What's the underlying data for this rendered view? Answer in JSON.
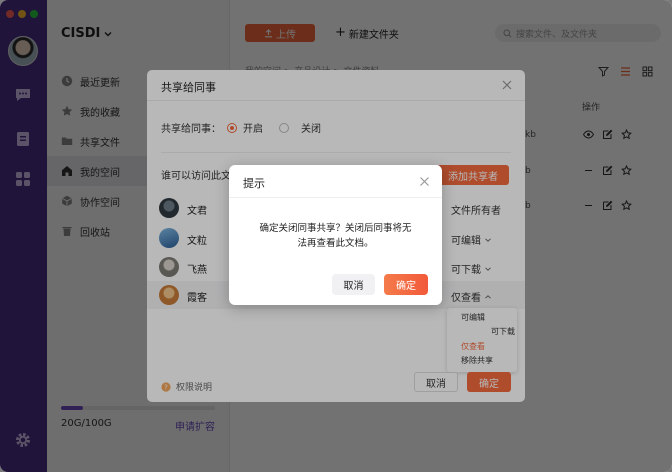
{
  "window": {
    "traffic_colors": [
      "#ff5f57",
      "#febc2e",
      "#28c840"
    ]
  },
  "sidebar": {
    "brand": "CISDI",
    "items": [
      {
        "label": "最近更新",
        "icon": "clock-icon"
      },
      {
        "label": "我的收藏",
        "icon": "star-icon"
      },
      {
        "label": "共享文件",
        "icon": "folder-icon"
      },
      {
        "label": "我的空间",
        "icon": "home-icon",
        "active": true
      },
      {
        "label": "协作空间",
        "icon": "cube-icon"
      },
      {
        "label": "回收站",
        "icon": "trash-icon"
      }
    ],
    "storage": {
      "used": "20G/100G",
      "fraction": 0.14,
      "expand_label": "申请扩容"
    }
  },
  "toolbar": {
    "upload_label": "上传",
    "new_folder_label": "新建文件夹",
    "search_placeholder": "搜索文件、及文件夹"
  },
  "breadcrumb": "我的空间 > 产品设计 > 文件资料",
  "file_list": {
    "op_header": "操作",
    "rows": [
      {
        "size": "kb"
      },
      {
        "size": "b"
      },
      {
        "size": "b"
      }
    ]
  },
  "share_dialog": {
    "title": "共享给同事",
    "toggle_label": "共享给同事：",
    "on_label": "开启",
    "off_label": "关闭",
    "who_label": "谁可以访问此文",
    "add_label": "添加共享者",
    "members": [
      {
        "name": "文君",
        "role": "文件所有者"
      },
      {
        "name": "文粒",
        "role": "可编辑"
      },
      {
        "name": "飞燕",
        "role": "可下载"
      },
      {
        "name": "霞客",
        "role": "仅查看"
      }
    ],
    "role_menu": [
      "可编辑",
      "可下载",
      "仅查看",
      "移除共享"
    ],
    "permission_note": "权限说明",
    "cancel_label": "取消",
    "ok_label": "确定"
  },
  "confirm_dialog": {
    "title": "提示",
    "message": "确定关闭同事共享？关闭后同事将无法再查看此文档。",
    "cancel_label": "取消",
    "ok_label": "确定"
  },
  "colors": {
    "accent": "#f26a3d",
    "rail": "#4b2f86",
    "brand_purple": "#6d4bc0"
  }
}
